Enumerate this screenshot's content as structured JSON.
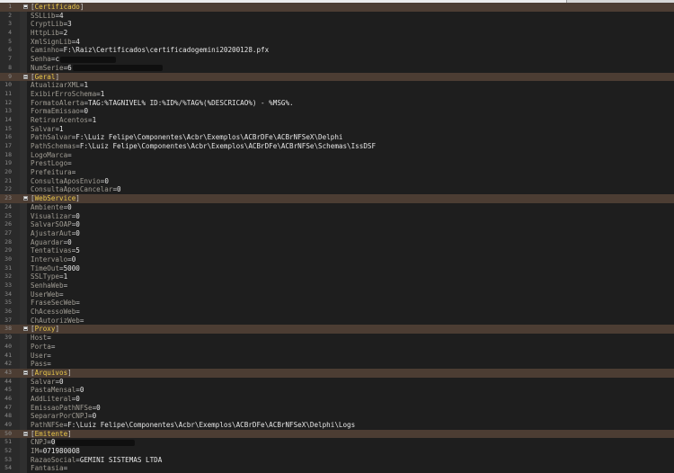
{
  "lines": [
    {
      "n": "1",
      "section": "Certificado"
    },
    {
      "n": "2",
      "key": "SSLLib",
      "value": "4"
    },
    {
      "n": "3",
      "key": "CryptLib",
      "value": "3"
    },
    {
      "n": "4",
      "key": "HttpLib",
      "value": "2"
    },
    {
      "n": "5",
      "key": "XmlSignLib",
      "value": "4"
    },
    {
      "n": "6",
      "key": "Caminho",
      "value": "F:\\Raiz\\Certificados\\certificadogemini20200128.pfx"
    },
    {
      "n": "7",
      "key": "Senha",
      "value": "c",
      "redacted": true
    },
    {
      "n": "8",
      "key": "NumSerie",
      "value": "6",
      "redacted": true
    },
    {
      "n": "9",
      "section": "Geral"
    },
    {
      "n": "10",
      "key": "AtualizarXML",
      "value": "1"
    },
    {
      "n": "11",
      "key": "ExibirErroSchema",
      "value": "1"
    },
    {
      "n": "12",
      "key": "FormatoAlerta",
      "value": "TAG:%TAGNIVEL% ID:%ID%/%TAG%(%DESCRICAO%) - %MSG%."
    },
    {
      "n": "13",
      "key": "FormaEmissao",
      "value": "0"
    },
    {
      "n": "14",
      "key": "RetirarAcentos",
      "value": "1"
    },
    {
      "n": "15",
      "key": "Salvar",
      "value": "1"
    },
    {
      "n": "16",
      "key": "PathSalvar",
      "value": "F:\\Luiz Felipe\\Componentes\\Acbr\\Exemplos\\ACBrDFe\\ACBrNFSeX\\Delphi"
    },
    {
      "n": "17",
      "key": "PathSchemas",
      "value": "F:\\Luiz Felipe\\Componentes\\Acbr\\Exemplos\\ACBrDFe\\ACBrNFSe\\Schemas\\IssDSF"
    },
    {
      "n": "18",
      "key": "LogoMarca",
      "value": ""
    },
    {
      "n": "19",
      "key": "PrestLogo",
      "value": ""
    },
    {
      "n": "20",
      "key": "Prefeitura",
      "value": ""
    },
    {
      "n": "21",
      "key": "ConsultaAposEnvio",
      "value": "0"
    },
    {
      "n": "22",
      "key": "ConsultaAposCancelar",
      "value": "0"
    },
    {
      "n": "23",
      "section": "WebService"
    },
    {
      "n": "24",
      "key": "Ambiente",
      "value": "0"
    },
    {
      "n": "25",
      "key": "Visualizar",
      "value": "0"
    },
    {
      "n": "26",
      "key": "SalvarSOAP",
      "value": "0"
    },
    {
      "n": "27",
      "key": "AjustarAut",
      "value": "0"
    },
    {
      "n": "28",
      "key": "Aguardar",
      "value": "0"
    },
    {
      "n": "29",
      "key": "Tentativas",
      "value": "5"
    },
    {
      "n": "30",
      "key": "Intervalo",
      "value": "0"
    },
    {
      "n": "31",
      "key": "TimeOut",
      "value": "5000"
    },
    {
      "n": "32",
      "key": "SSLType",
      "value": "1"
    },
    {
      "n": "33",
      "key": "SenhaWeb",
      "value": ""
    },
    {
      "n": "34",
      "key": "UserWeb",
      "value": ""
    },
    {
      "n": "35",
      "key": "FraseSecWeb",
      "value": ""
    },
    {
      "n": "36",
      "key": "ChAcessoWeb",
      "value": ""
    },
    {
      "n": "37",
      "key": "ChAutorizWeb",
      "value": ""
    },
    {
      "n": "38",
      "section": "Proxy"
    },
    {
      "n": "39",
      "key": "Host",
      "value": ""
    },
    {
      "n": "40",
      "key": "Porta",
      "value": ""
    },
    {
      "n": "41",
      "key": "User",
      "value": ""
    },
    {
      "n": "42",
      "key": "Pass",
      "value": ""
    },
    {
      "n": "43",
      "section": "Arquivos"
    },
    {
      "n": "44",
      "key": "Salvar",
      "value": "0"
    },
    {
      "n": "45",
      "key": "PastaMensal",
      "value": "0"
    },
    {
      "n": "46",
      "key": "AddLiteral",
      "value": "0"
    },
    {
      "n": "47",
      "key": "EmissaoPathNFSe",
      "value": "0"
    },
    {
      "n": "48",
      "key": "SepararPorCNPJ",
      "value": "0"
    },
    {
      "n": "49",
      "key": "PathNFSe",
      "value": "F:\\Luiz Felipe\\Componentes\\Acbr\\Exemplos\\ACBrDFe\\ACBrNFSeX\\Delphi\\Logs"
    },
    {
      "n": "50",
      "section": "Emitente"
    },
    {
      "n": "51",
      "key": "CNPJ",
      "value": "0",
      "redacted": true
    },
    {
      "n": "52",
      "key": "IM",
      "value": "071980008"
    },
    {
      "n": "53",
      "key": "RazaoSocial",
      "value": "GEMINI SISTEMAS LTDA"
    },
    {
      "n": "54",
      "key": "Fantasia",
      "value": ""
    }
  ]
}
